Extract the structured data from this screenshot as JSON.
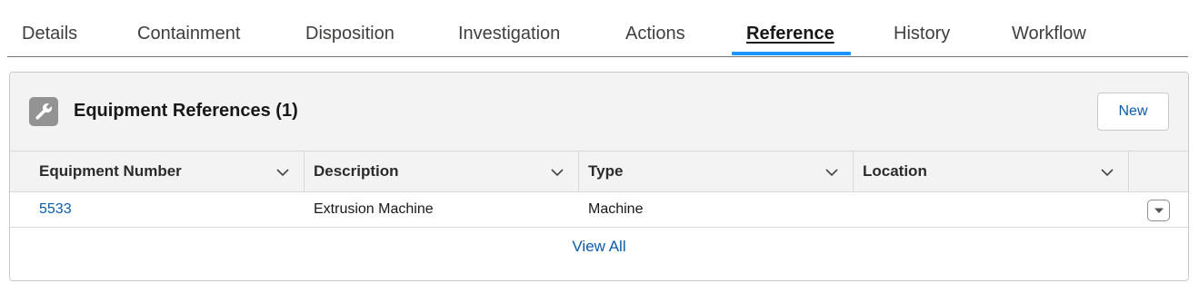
{
  "tabs": [
    {
      "label": "Details"
    },
    {
      "label": "Containment"
    },
    {
      "label": "Disposition"
    },
    {
      "label": "Investigation"
    },
    {
      "label": "Actions"
    },
    {
      "label": "Reference",
      "active": true
    },
    {
      "label": "History"
    },
    {
      "label": "Workflow"
    }
  ],
  "card": {
    "icon": "wrench-icon",
    "title": "Equipment References (1)",
    "new_label": "New",
    "columns": [
      {
        "label": "Equipment Number"
      },
      {
        "label": "Description"
      },
      {
        "label": "Type"
      },
      {
        "label": "Location"
      }
    ],
    "rows": [
      {
        "equipment_number": "5533",
        "description": "Extrusion Machine",
        "type": "Machine",
        "location": ""
      }
    ],
    "view_all_label": "View All"
  },
  "colors": {
    "accent": "#1b96ff",
    "link": "#0b5cab",
    "header_bg": "#f3f3f3",
    "icon_bg": "#939393"
  }
}
